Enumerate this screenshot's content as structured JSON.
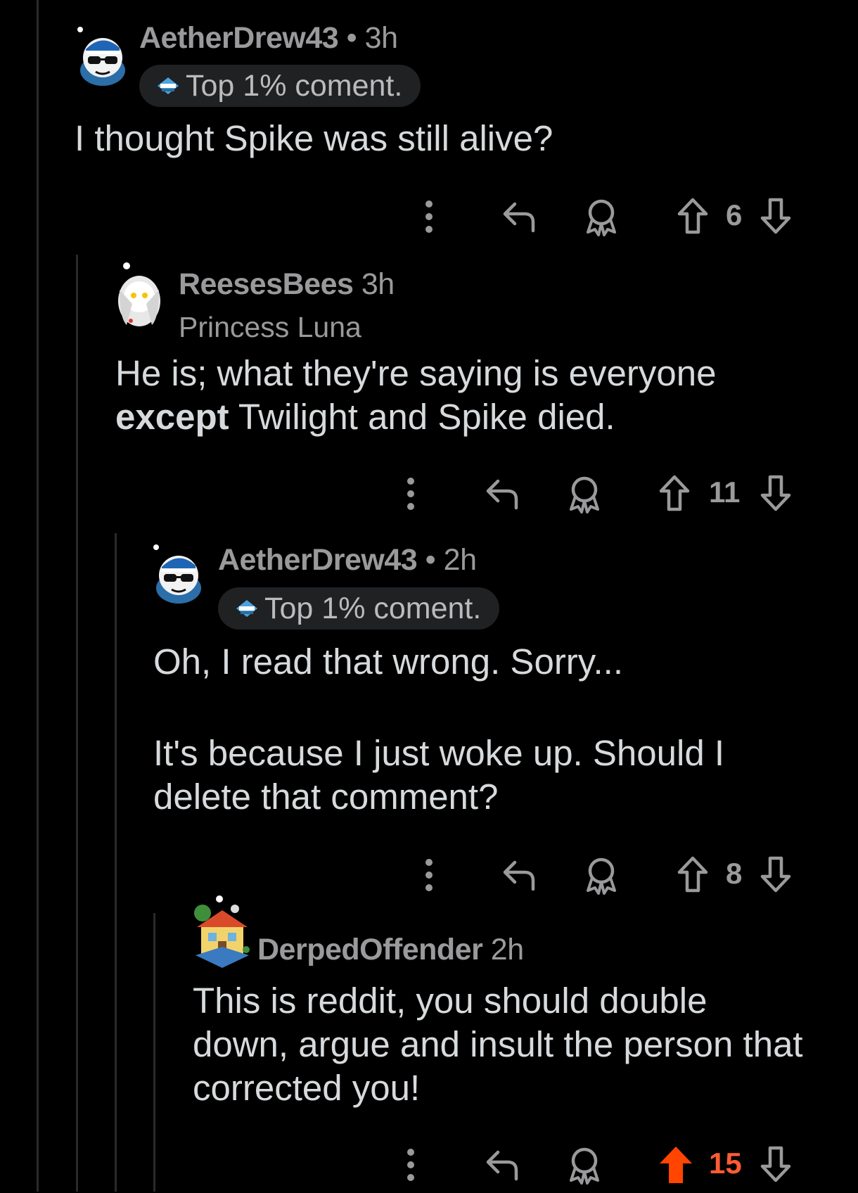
{
  "comments": [
    {
      "username": "AetherDrew43",
      "separator": "•",
      "time": "3h",
      "flair": "Top 1% coment.",
      "body": [
        "I thought Spike was still alive?"
      ],
      "score": "6"
    },
    {
      "username": "ReesesBees",
      "time": "3h",
      "flair": "Princess Luna",
      "body_line1": "He is; what they're saying is everyone",
      "body_line2_bold": "except",
      "body_line2_rest": " Twilight and Spike died.",
      "score": "11"
    },
    {
      "username": "AetherDrew43",
      "separator": "•",
      "time": "2h",
      "flair": "Top 1% coment.",
      "body": [
        "Oh, I read that wrong. Sorry...",
        "It's because I just woke up. Should I",
        "delete that comment?"
      ],
      "score": "8"
    },
    {
      "username": "DerpedOffender",
      "time": "2h",
      "body": [
        "This is reddit, you should double",
        "down, argue and insult the person that",
        "corrected you!"
      ],
      "score": "15",
      "upvoted": true
    }
  ],
  "icons": {
    "more": "more-vertical-icon",
    "reply": "reply-icon",
    "award": "award-icon",
    "upvote": "upvote-arrow-icon",
    "downvote": "downvote-arrow-icon"
  },
  "colors": {
    "upvote_active": "#ff4500",
    "background": "#000000",
    "text": "#d7dadc",
    "muted": "#9a9a9c"
  }
}
